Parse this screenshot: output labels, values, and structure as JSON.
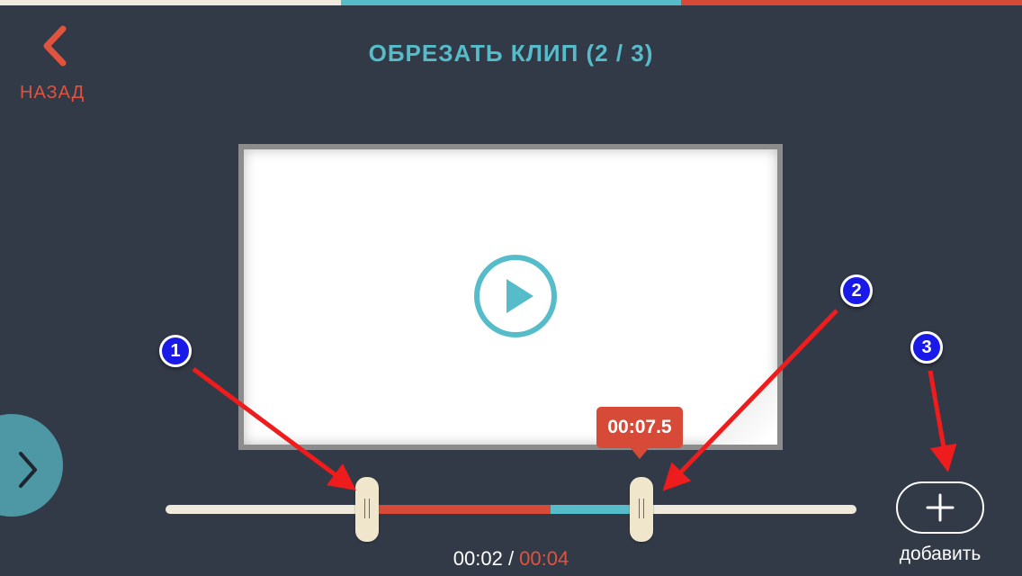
{
  "header": {
    "back_label": "НАЗАД",
    "title": "ОБРЕЗАТЬ КЛИП (2 / 3)"
  },
  "progress_colors": [
    "#efeadb",
    "#57bcc9",
    "#d64a37"
  ],
  "player": {
    "tooltip_time": "00:07.5"
  },
  "time": {
    "current": "00:02",
    "separator": " / ",
    "total": "00:04"
  },
  "add": {
    "label": "добавить"
  },
  "annotations": [
    "1",
    "2",
    "3"
  ],
  "colors": {
    "background": "#323a47",
    "accent_teal": "#57bcc9",
    "accent_red": "#d64a37",
    "track": "#efeadb",
    "badge": "#1a1ae8",
    "arrow": "#ee1c1c"
  },
  "icons": {
    "back": "chevron-left-icon",
    "play": "play-circle-icon",
    "next": "chevron-right-icon",
    "add": "plus-icon"
  }
}
